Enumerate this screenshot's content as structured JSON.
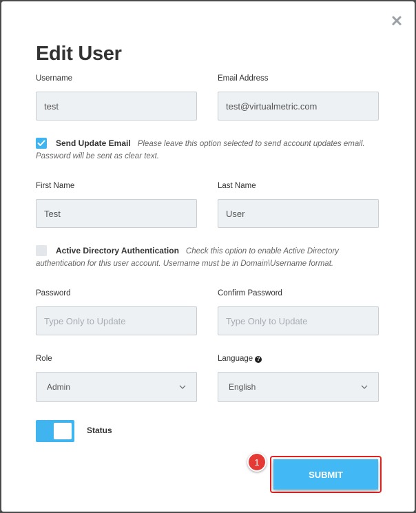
{
  "modal": {
    "title": "Edit User",
    "close_icon": "close-icon"
  },
  "fields": {
    "username": {
      "label": "Username",
      "value": "test",
      "placeholder": ""
    },
    "email": {
      "label": "Email Address",
      "value": "test@virtualmetric.com",
      "placeholder": ""
    },
    "first_name": {
      "label": "First Name",
      "value": "Test",
      "placeholder": ""
    },
    "last_name": {
      "label": "Last Name",
      "value": "User",
      "placeholder": ""
    },
    "password": {
      "label": "Password",
      "value": "",
      "placeholder": "Type Only to Update"
    },
    "confirm_password": {
      "label": "Confirm Password",
      "value": "",
      "placeholder": "Type Only to Update"
    },
    "role": {
      "label": "Role",
      "selected": "Admin"
    },
    "language": {
      "label": "Language",
      "selected": "English",
      "help_icon": "question-circle-icon"
    }
  },
  "options": {
    "send_update_email": {
      "label": "Send Update Email",
      "description": "Please leave this option selected to send account updates email. Password will be sent as clear text.",
      "checked": true
    },
    "active_directory": {
      "label": "Active Directory Authentication",
      "description": "Check this option to enable Active Directory authentication for this user account. Username must be in Domain\\Username format.",
      "checked": false
    }
  },
  "status": {
    "label": "Status",
    "enabled": true
  },
  "submit": {
    "label": "SUBMIT"
  },
  "annotation": {
    "badge": "1"
  },
  "colors": {
    "accent": "#3fb4ef",
    "highlight_border": "#e02424",
    "badge": "#e53935",
    "input_bg": "#eef1f4"
  }
}
